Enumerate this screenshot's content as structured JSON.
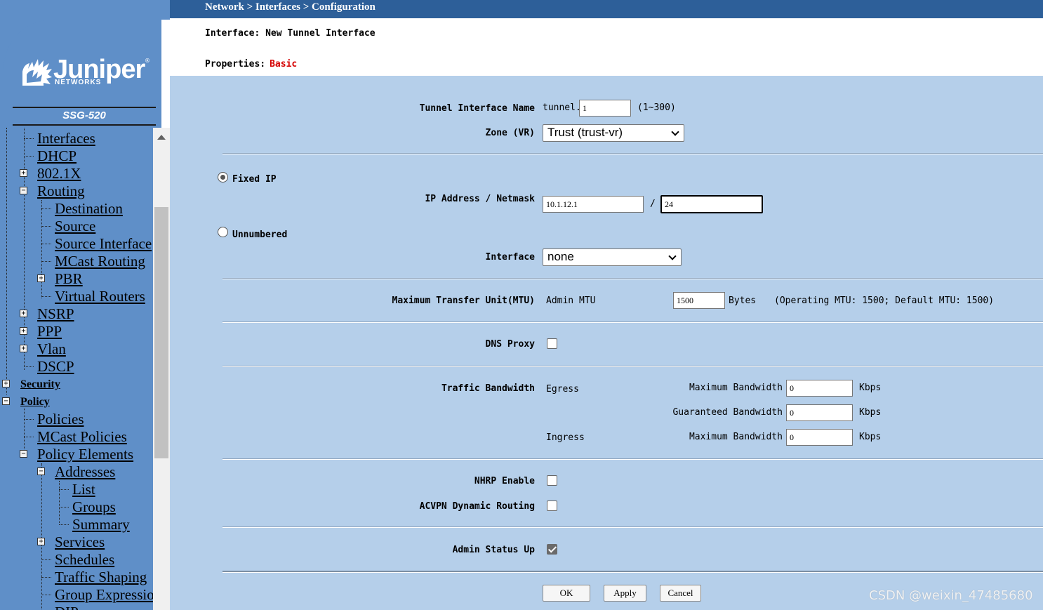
{
  "breadcrumb": "Network > Interfaces > Configuration",
  "page_title": "Interface: New Tunnel Interface",
  "properties": {
    "label": "Properties:",
    "value": "Basic"
  },
  "brand": {
    "name": "Juniper",
    "sub": "NETWORKS",
    "reg": "®",
    "model": "SSG-520"
  },
  "nav": {
    "items": [
      {
        "label": "Interfaces"
      },
      {
        "label": "DHCP"
      },
      {
        "label": "802.1X"
      },
      {
        "label": "Routing"
      },
      {
        "label": "Destination"
      },
      {
        "label": "Source"
      },
      {
        "label": "Source Interface"
      },
      {
        "label": "MCast Routing"
      },
      {
        "label": "PBR"
      },
      {
        "label": "Virtual Routers"
      },
      {
        "label": "NSRP"
      },
      {
        "label": "PPP"
      },
      {
        "label": "Vlan"
      },
      {
        "label": "DSCP"
      },
      {
        "label": "Security"
      },
      {
        "label": "Policy"
      },
      {
        "label": "Policies"
      },
      {
        "label": "MCast Policies"
      },
      {
        "label": "Policy Elements"
      },
      {
        "label": "Addresses"
      },
      {
        "label": "List"
      },
      {
        "label": "Groups"
      },
      {
        "label": "Summary"
      },
      {
        "label": "Services"
      },
      {
        "label": "Schedules"
      },
      {
        "label": "Traffic Shaping"
      },
      {
        "label": "Group Expressions"
      },
      {
        "label": "DIP"
      }
    ]
  },
  "form": {
    "tunnel_name": {
      "label": "Tunnel Interface Name",
      "prefix": "tunnel.",
      "value": "1",
      "range": "(1~300)"
    },
    "zone": {
      "label": "Zone (VR)",
      "value": "Trust (trust-vr)"
    },
    "fixed_ip": {
      "label": "Fixed IP",
      "checked": true
    },
    "ip_netmask": {
      "label": "IP Address / Netmask",
      "ip": "10.1.12.1",
      "sep": "/",
      "mask": "24"
    },
    "unnumbered": {
      "label": "Unnumbered",
      "checked": false
    },
    "interface": {
      "label": "Interface",
      "value": "none"
    },
    "mtu": {
      "label": "Maximum Transfer Unit(MTU)",
      "sub": "Admin MTU",
      "value": "1500",
      "unit": "Bytes",
      "info": "(Operating MTU: 1500; Default MTU: 1500)"
    },
    "dns_proxy": {
      "label": "DNS Proxy",
      "checked": false
    },
    "bandwidth": {
      "label": "Traffic Bandwidth",
      "egress": "Egress",
      "ingress": "Ingress",
      "egress_max_label": "Maximum Bandwidth",
      "egress_max": "0",
      "egress_guar_label": "Guaranteed Bandwidth",
      "egress_guar": "0",
      "ingress_max_label": "Maximum Bandwidth",
      "ingress_max": "0",
      "unit": "Kbps"
    },
    "nhrp": {
      "label": "NHRP Enable",
      "checked": false
    },
    "acvpn": {
      "label": "ACVPN Dynamic Routing",
      "checked": false
    },
    "admin_status": {
      "label": "Admin Status Up",
      "checked": true
    }
  },
  "buttons": {
    "ok": "OK",
    "apply": "Apply",
    "cancel": "Cancel"
  },
  "watermark": "CSDN @weixin_47485680"
}
